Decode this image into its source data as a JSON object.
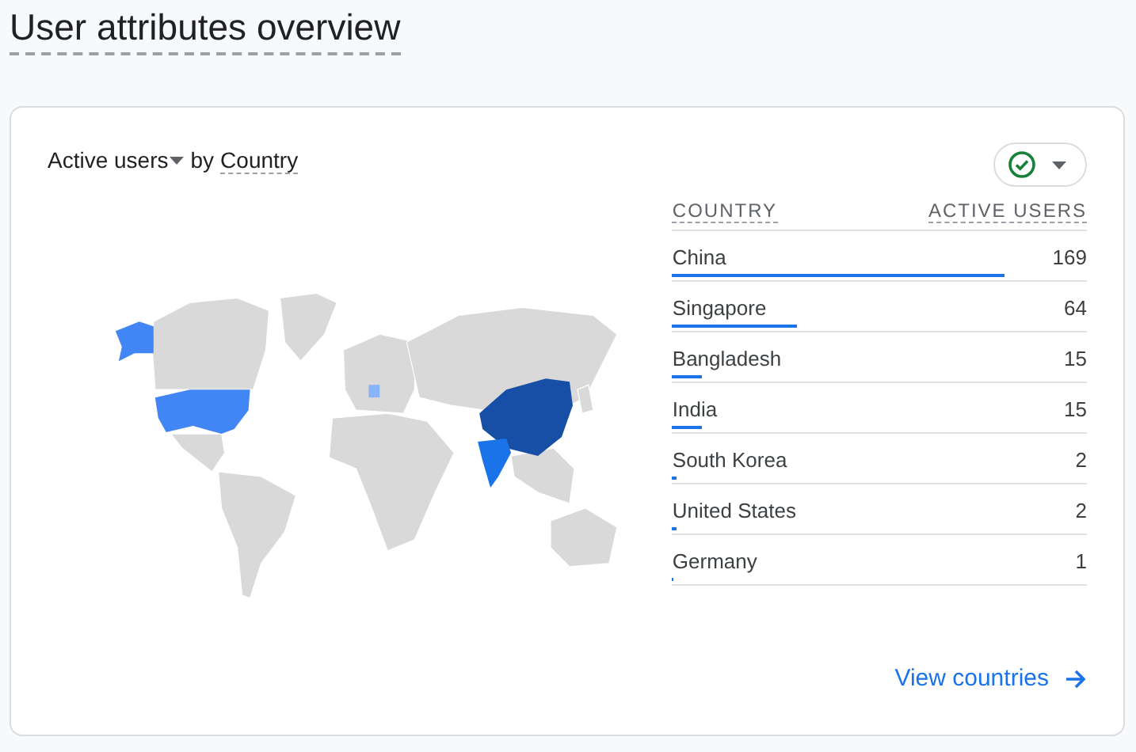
{
  "page_title": "User attributes overview",
  "card": {
    "metric": "Active users",
    "connector": "by",
    "dimension": "Country",
    "status_ok": true,
    "table": {
      "columns": [
        "COUNTRY",
        "ACTIVE USERS"
      ],
      "rows": [
        {
          "name": "China",
          "value": "169",
          "level": 0.8
        },
        {
          "name": "Singapore",
          "value": "64",
          "level": 0.3
        },
        {
          "name": "Bangladesh",
          "value": "15",
          "level": 0.07
        },
        {
          "name": "India",
          "value": "15",
          "level": 0.07
        },
        {
          "name": "South Korea",
          "value": "2",
          "level": 0.01
        },
        {
          "name": "United States",
          "value": "2",
          "level": 0.01
        },
        {
          "name": "Germany",
          "value": "1",
          "level": 0.004
        }
      ]
    },
    "link": "View countries"
  }
}
